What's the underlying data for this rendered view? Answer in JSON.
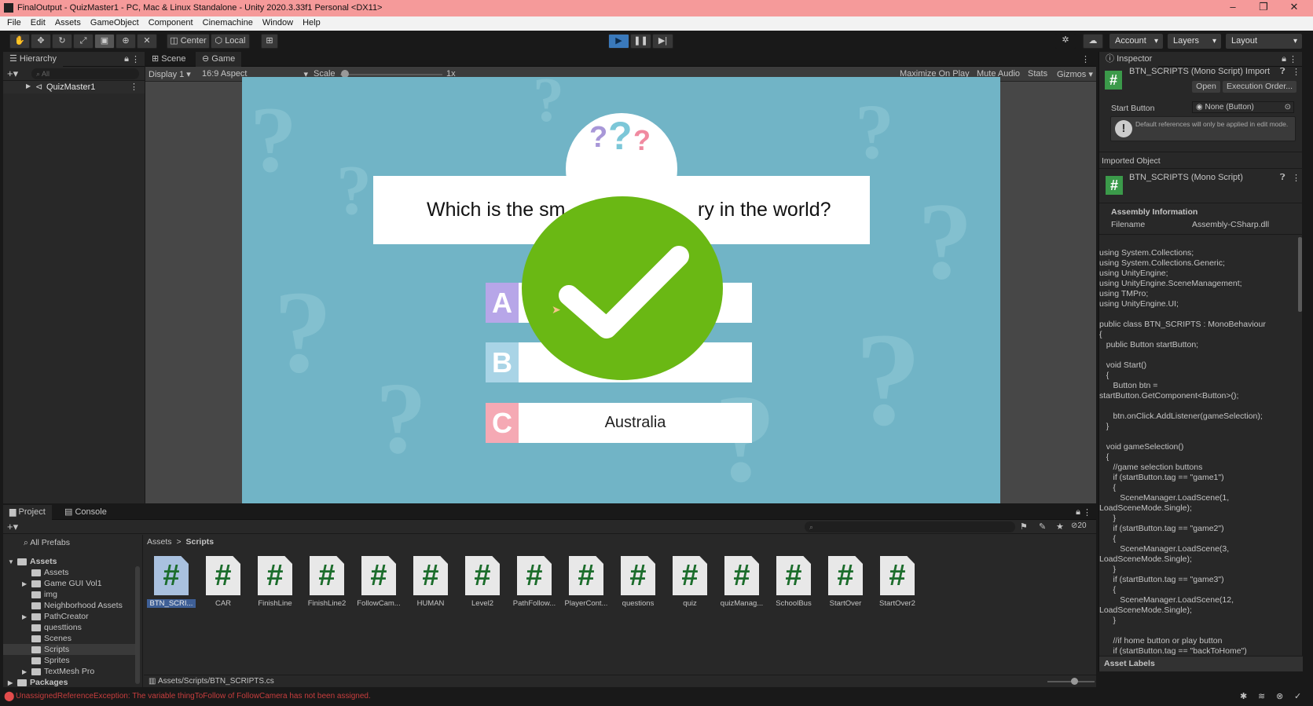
{
  "window": {
    "title": "FinalOutput - QuizMaster1 - PC, Mac & Linux Standalone - Unity 2020.3.33f1 Personal <DX11>",
    "minimize": "–",
    "maximize": "❐",
    "close": "✕"
  },
  "menu": [
    "File",
    "Edit",
    "Assets",
    "GameObject",
    "Component",
    "Cinemachine",
    "Window",
    "Help"
  ],
  "toolbar": {
    "center": "Center",
    "local": "Local",
    "account": "Account",
    "layers": "Layers",
    "layout": "Layout"
  },
  "hierarchy": {
    "tab": "Hierarchy",
    "search_placeholder": "All",
    "root": "QuizMaster1"
  },
  "scene_tabs": {
    "scene": "Scene",
    "game": "Game"
  },
  "game_bar": {
    "display": "Display 1",
    "aspect": "16:9 Aspect",
    "scale_label": "Scale",
    "scale_value": "1x",
    "maximize": "Maximize On Play",
    "mute": "Mute Audio",
    "stats": "Stats",
    "gizmos": "Gizmos"
  },
  "quiz": {
    "question": "Which is the smallest country in the world?",
    "question_left": "Which is the sm",
    "question_right": "ry in the world?",
    "options": [
      {
        "letter": "A",
        "text": ""
      },
      {
        "letter": "B",
        "text": ""
      },
      {
        "letter": "C",
        "text": "Australia"
      }
    ],
    "colors": {
      "a": "#b7a6e8",
      "b": "#a9d4e6",
      "c": "#f5a9b4",
      "check": "#6ab814",
      "bg": "#71b4c6"
    }
  },
  "inspector": {
    "tab": "Inspector",
    "title": "BTN_SCRIPTS (Mono Script) Import",
    "open": "Open",
    "exec_order": "Execution Order...",
    "field_label": "Start Button",
    "field_value": "None (Button)",
    "warning": "Default references will only be applied in edit mode.",
    "imported_object": "Imported Object",
    "script_name": "BTN_SCRIPTS (Mono Script)",
    "assembly_info": "Assembly Information",
    "filename_label": "Filename",
    "filename_value": "Assembly-CSharp.dll",
    "asset_labels": "Asset Labels",
    "code": "using System.Collections;\nusing System.Collections.Generic;\nusing UnityEngine;\nusing UnityEngine.SceneManagement;\nusing TMPro;\nusing UnityEngine.UI;\n\npublic class BTN_SCRIPTS : MonoBehaviour\n{\n   public Button startButton;\n\n   void Start()\n   {\n      Button btn =\nstartButton.GetComponent<Button>();\n\n      btn.onClick.AddListener(gameSelection);\n   }\n\n   void gameSelection()\n   {\n      //game selection buttons\n      if (startButton.tag == \"game1\")\n      {\n         SceneManager.LoadScene(1,\nLoadSceneMode.Single);\n      }\n      if (startButton.tag == \"game2\")\n      {\n         SceneManager.LoadScene(3,\nLoadSceneMode.Single);\n      }\n      if (startButton.tag == \"game3\")\n      {\n         SceneManager.LoadScene(12,\nLoadSceneMode.Single);\n      }\n\n      //if home button or play button\n      if (startButton.tag == \"backToHome\")"
  },
  "project": {
    "tab_project": "Project",
    "tab_console": "Console",
    "all_prefabs": "All Prefabs",
    "breadcrumb_root": "Assets",
    "breadcrumb_sep": ">",
    "breadcrumb_leaf": "Scripts",
    "hidden_count": "20",
    "path": "Assets/Scripts/BTN_SCRIPTS.cs",
    "tree": [
      {
        "label": "Assets",
        "level": 0,
        "bold": true,
        "sel": false
      },
      {
        "label": "Assets",
        "level": 1,
        "bold": false,
        "sel": false
      },
      {
        "label": "Game GUI Vol1",
        "level": 1,
        "bold": false,
        "sel": false
      },
      {
        "label": "img",
        "level": 1,
        "bold": false,
        "sel": false
      },
      {
        "label": "Neighborhood Assets",
        "level": 1,
        "bold": false,
        "sel": false
      },
      {
        "label": "PathCreator",
        "level": 1,
        "bold": false,
        "sel": false
      },
      {
        "label": "questtions",
        "level": 1,
        "bold": false,
        "sel": false
      },
      {
        "label": "Scenes",
        "level": 1,
        "bold": false,
        "sel": false
      },
      {
        "label": "Scripts",
        "level": 1,
        "bold": false,
        "sel": true
      },
      {
        "label": "Sprites",
        "level": 1,
        "bold": false,
        "sel": false
      },
      {
        "label": "TextMesh Pro",
        "level": 1,
        "bold": false,
        "sel": false
      },
      {
        "label": "Packages",
        "level": 0,
        "bold": true,
        "sel": false
      }
    ],
    "assets": [
      "BTN_SCRI...",
      "CAR",
      "FinishLine",
      "FinishLine2",
      "FollowCam...",
      "HUMAN",
      "Level2",
      "PathFollow...",
      "PlayerCont...",
      "questions",
      "quiz",
      "quizManag...",
      "SchoolBus",
      "StartOver",
      "StartOver2"
    ]
  },
  "status": {
    "error": "UnassignedReferenceException: The variable thingToFollow of FollowCamera has not been assigned."
  }
}
